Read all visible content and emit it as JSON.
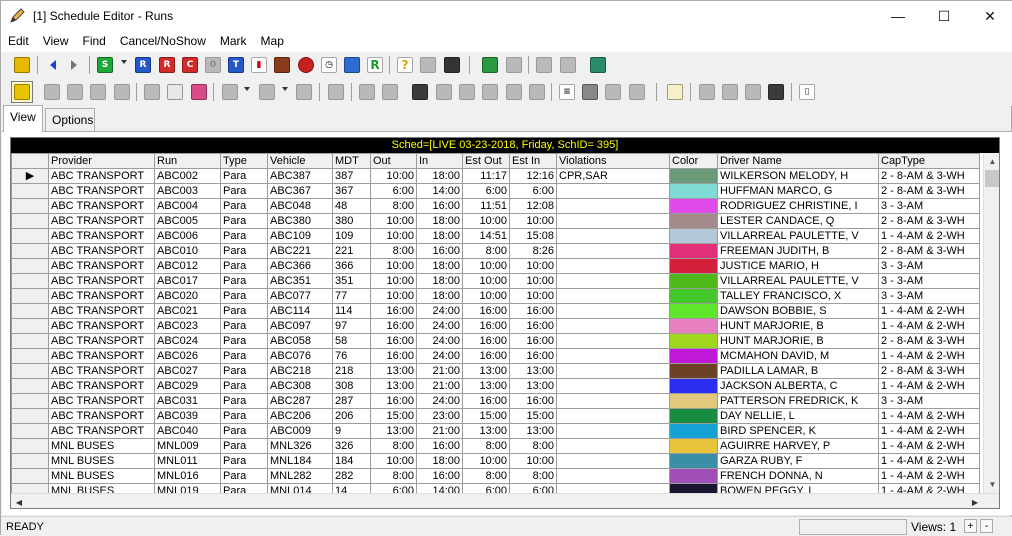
{
  "window": {
    "title": "[1] Schedule Editor - Runs",
    "minimize": "—",
    "maximize": "☐",
    "close": "✕"
  },
  "menu": [
    "Edit",
    "View",
    "Find",
    "Cancel/NoShow",
    "Mark",
    "Map"
  ],
  "tabs": [
    {
      "label": "View",
      "active": true
    },
    {
      "label": "Options",
      "active": false
    }
  ],
  "grid": {
    "banner": "Sched=[LIVE 03-23-2018, Friday, SchID= 395]",
    "columns": [
      "Provider",
      "Run",
      "Type",
      "Vehicle",
      "MDT",
      "Out",
      "In",
      "Est Out",
      "Est In",
      "Violations",
      "Color",
      "Driver Name",
      "CapType"
    ],
    "current_row_marker": "▶",
    "rows": [
      {
        "provider": "ABC TRANSPORT",
        "run": "ABC002",
        "type": "Para",
        "vehicle": "ABC387",
        "mdt": "387",
        "out": "10:00",
        "in": "18:00",
        "est_out": "11:17",
        "est_in": "12:16",
        "violations": "CPR,SAR",
        "color": "#6b9a78",
        "driver": "WILKERSON MELODY, H",
        "captype": "2 - 8-AM & 3-WH"
      },
      {
        "provider": "ABC TRANSPORT",
        "run": "ABC003",
        "type": "Para",
        "vehicle": "ABC367",
        "mdt": "367",
        "out": "6:00",
        "in": "14:00",
        "est_out": "6:00",
        "est_in": "6:00",
        "violations": "",
        "color": "#7fdcd4",
        "driver": "HUFFMAN MARCO, G",
        "captype": "2 - 8-AM & 3-WH"
      },
      {
        "provider": "ABC TRANSPORT",
        "run": "ABC004",
        "type": "Para",
        "vehicle": "ABC048",
        "mdt": "48",
        "out": "8:00",
        "in": "16:00",
        "est_out": "11:51",
        "est_in": "12:08",
        "violations": "",
        "color": "#e14be9",
        "driver": "RODRIGUEZ CHRISTINE, I",
        "captype": "3 - 3-AM"
      },
      {
        "provider": "ABC TRANSPORT",
        "run": "ABC005",
        "type": "Para",
        "vehicle": "ABC380",
        "mdt": "380",
        "out": "10:00",
        "in": "18:00",
        "est_out": "10:00",
        "est_in": "10:00",
        "violations": "",
        "color": "#a38a8b",
        "driver": "LESTER CANDACE, Q",
        "captype": "2 - 8-AM & 3-WH"
      },
      {
        "provider": "ABC TRANSPORT",
        "run": "ABC006",
        "type": "Para",
        "vehicle": "ABC109",
        "mdt": "109",
        "out": "10:00",
        "in": "18:00",
        "est_out": "14:51",
        "est_in": "15:08",
        "violations": "",
        "color": "#b3c7d9",
        "driver": "VILLARREAL PAULETTE, V",
        "captype": "1 - 4-AM & 2-WH"
      },
      {
        "provider": "ABC TRANSPORT",
        "run": "ABC010",
        "type": "Para",
        "vehicle": "ABC221",
        "mdt": "221",
        "out": "8:00",
        "in": "16:00",
        "est_out": "8:00",
        "est_in": "8:26",
        "violations": "",
        "color": "#e0307a",
        "driver": "FREEMAN JUDITH, B",
        "captype": "2 - 8-AM & 3-WH"
      },
      {
        "provider": "ABC TRANSPORT",
        "run": "ABC012",
        "type": "Para",
        "vehicle": "ABC366",
        "mdt": "366",
        "out": "10:00",
        "in": "18:00",
        "est_out": "10:00",
        "est_in": "10:00",
        "violations": "",
        "color": "#d3203a",
        "driver": "JUSTICE MARIO, H",
        "captype": "3 - 3-AM"
      },
      {
        "provider": "ABC TRANSPORT",
        "run": "ABC017",
        "type": "Para",
        "vehicle": "ABC351",
        "mdt": "351",
        "out": "10:00",
        "in": "18:00",
        "est_out": "10:00",
        "est_in": "10:00",
        "violations": "",
        "color": "#4cb81a",
        "driver": "VILLARREAL PAULETTE, V",
        "captype": "3 - 3-AM"
      },
      {
        "provider": "ABC TRANSPORT",
        "run": "ABC020",
        "type": "Para",
        "vehicle": "ABC077",
        "mdt": "77",
        "out": "10:00",
        "in": "18:00",
        "est_out": "10:00",
        "est_in": "10:00",
        "violations": "",
        "color": "#45c82a",
        "driver": "TALLEY FRANCISCO, X",
        "captype": "3 - 3-AM"
      },
      {
        "provider": "ABC TRANSPORT",
        "run": "ABC021",
        "type": "Para",
        "vehicle": "ABC114",
        "mdt": "114",
        "out": "16:00",
        "in": "24:00",
        "est_out": "16:00",
        "est_in": "16:00",
        "violations": "",
        "color": "#5ee52c",
        "driver": "DAWSON BOBBIE, S",
        "captype": "1 - 4-AM & 2-WH"
      },
      {
        "provider": "ABC TRANSPORT",
        "run": "ABC023",
        "type": "Para",
        "vehicle": "ABC097",
        "mdt": "97",
        "out": "16:00",
        "in": "24:00",
        "est_out": "16:00",
        "est_in": "16:00",
        "violations": "",
        "color": "#e77fc0",
        "driver": "HUNT MARJORIE, B",
        "captype": "1 - 4-AM & 2-WH"
      },
      {
        "provider": "ABC TRANSPORT",
        "run": "ABC024",
        "type": "Para",
        "vehicle": "ABC058",
        "mdt": "58",
        "out": "16:00",
        "in": "24:00",
        "est_out": "16:00",
        "est_in": "16:00",
        "violations": "",
        "color": "#a0d61e",
        "driver": "HUNT MARJORIE, B",
        "captype": "2 - 8-AM & 3-WH"
      },
      {
        "provider": "ABC TRANSPORT",
        "run": "ABC026",
        "type": "Para",
        "vehicle": "ABC076",
        "mdt": "76",
        "out": "16:00",
        "in": "24:00",
        "est_out": "16:00",
        "est_in": "16:00",
        "violations": "",
        "color": "#c118d8",
        "driver": "MCMAHON DAVID, M",
        "captype": "1 - 4-AM & 2-WH"
      },
      {
        "provider": "ABC TRANSPORT",
        "run": "ABC027",
        "type": "Para",
        "vehicle": "ABC218",
        "mdt": "218",
        "out": "13:00",
        "in": "21:00",
        "est_out": "13:00",
        "est_in": "13:00",
        "violations": "",
        "color": "#6b4226",
        "driver": "PADILLA LAMAR, B",
        "captype": "2 - 8-AM & 3-WH"
      },
      {
        "provider": "ABC TRANSPORT",
        "run": "ABC029",
        "type": "Para",
        "vehicle": "ABC308",
        "mdt": "308",
        "out": "13:00",
        "in": "21:00",
        "est_out": "13:00",
        "est_in": "13:00",
        "violations": "",
        "color": "#2b2df0",
        "driver": "JACKSON ALBERTA, C",
        "captype": "1 - 4-AM & 2-WH"
      },
      {
        "provider": "ABC TRANSPORT",
        "run": "ABC031",
        "type": "Para",
        "vehicle": "ABC287",
        "mdt": "287",
        "out": "16:00",
        "in": "24:00",
        "est_out": "16:00",
        "est_in": "16:00",
        "violations": "",
        "color": "#e3c77a",
        "driver": "PATTERSON FREDRICK, K",
        "captype": "3 - 3-AM"
      },
      {
        "provider": "ABC TRANSPORT",
        "run": "ABC039",
        "type": "Para",
        "vehicle": "ABC206",
        "mdt": "206",
        "out": "15:00",
        "in": "23:00",
        "est_out": "15:00",
        "est_in": "15:00",
        "violations": "",
        "color": "#178c3c",
        "driver": "DAY NELLIE, L",
        "captype": "1 - 4-AM & 2-WH"
      },
      {
        "provider": "ABC TRANSPORT",
        "run": "ABC040",
        "type": "Para",
        "vehicle": "ABC009",
        "mdt": "9",
        "out": "13:00",
        "in": "21:00",
        "est_out": "13:00",
        "est_in": "13:00",
        "violations": "",
        "color": "#17a2d6",
        "driver": "BIRD SPENCER, K",
        "captype": "1 - 4-AM & 2-WH"
      },
      {
        "provider": "MNL BUSES",
        "run": "MNL009",
        "type": "Para",
        "vehicle": "MNL326",
        "mdt": "326",
        "out": "8:00",
        "in": "16:00",
        "est_out": "8:00",
        "est_in": "8:00",
        "violations": "",
        "color": "#e8c33c",
        "driver": "AGUIRRE HARVEY, P",
        "captype": "1 - 4-AM & 2-WH"
      },
      {
        "provider": "MNL BUSES",
        "run": "MNL011",
        "type": "Para",
        "vehicle": "MNL184",
        "mdt": "184",
        "out": "10:00",
        "in": "18:00",
        "est_out": "10:00",
        "est_in": "10:00",
        "violations": "",
        "color": "#3b8ea7",
        "driver": "GARZA RUBY, F",
        "captype": "1 - 4-AM & 2-WH"
      },
      {
        "provider": "MNL BUSES",
        "run": "MNL016",
        "type": "Para",
        "vehicle": "MNL282",
        "mdt": "282",
        "out": "8:00",
        "in": "16:00",
        "est_out": "8:00",
        "est_in": "8:00",
        "violations": "",
        "color": "#a04fb8",
        "driver": "FRENCH DONNA, N",
        "captype": "1 - 4-AM & 2-WH"
      },
      {
        "provider": "MNL BUSES",
        "run": "MNL019",
        "type": "Para",
        "vehicle": "MNL014",
        "mdt": "14",
        "out": "6:00",
        "in": "14:00",
        "est_out": "6:00",
        "est_in": "6:00",
        "violations": "",
        "color": "#1a1530",
        "driver": "BOWEN PEGGY, L",
        "captype": "1 - 4-AM & 2-WH"
      }
    ]
  },
  "status": {
    "ready": "READY",
    "views_label": "Views:",
    "views_count": "1",
    "plus": "+",
    "minus": "-"
  }
}
